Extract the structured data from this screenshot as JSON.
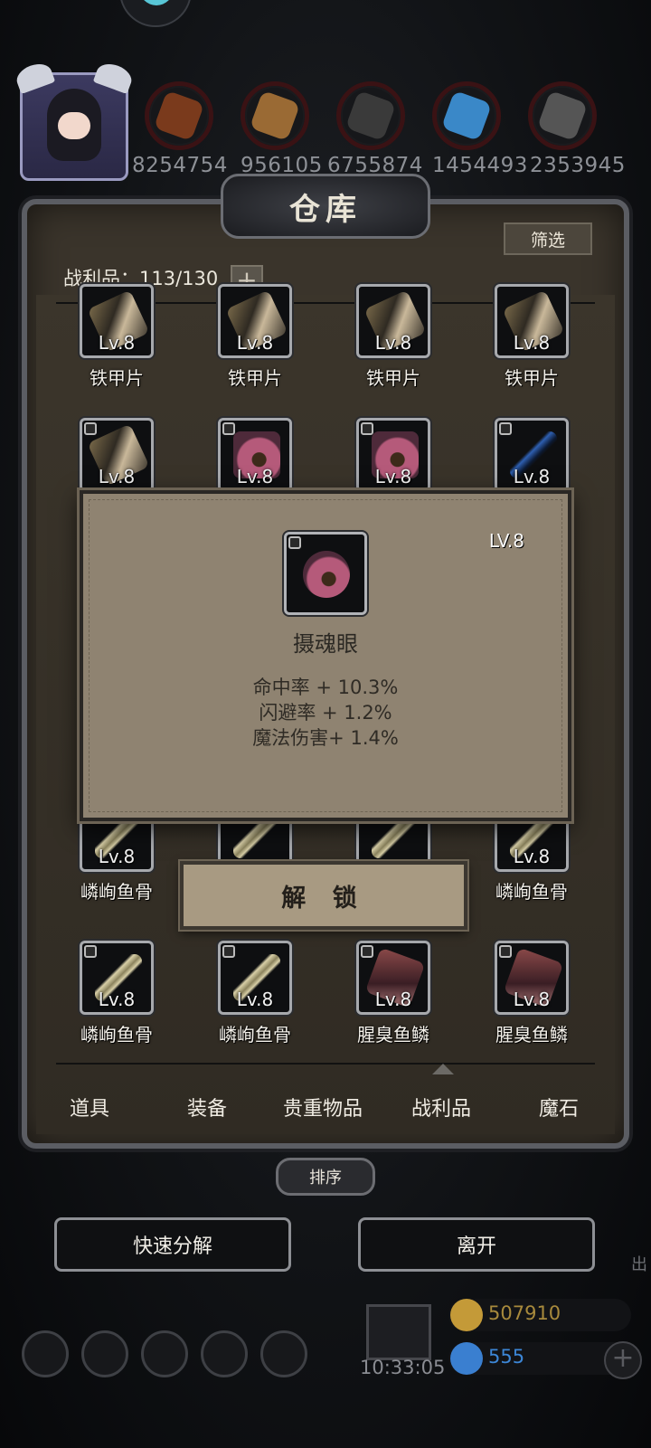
{
  "resources": [
    {
      "icon": "meat-icon",
      "color": "#7a3a1c",
      "count": "8254754"
    },
    {
      "icon": "wood-icon",
      "color": "#9a6a34",
      "count": "956105"
    },
    {
      "icon": "stone-icon",
      "color": "#3a3a3a",
      "count": "6755874"
    },
    {
      "icon": "crystal-icon",
      "color": "#3a88c8",
      "count": "1454493"
    },
    {
      "icon": "iron-icon",
      "color": "#555",
      "count": "2353945"
    }
  ],
  "warehouse": {
    "title": "仓库",
    "filter_label": "筛选",
    "capacity_label": "战利品：113/130",
    "plus_label": "+"
  },
  "grid_rows": [
    [
      {
        "name": "铁甲片",
        "level": "Lv.8",
        "art": "iron"
      },
      {
        "name": "铁甲片",
        "level": "Lv.8",
        "art": "iron"
      },
      {
        "name": "铁甲片",
        "level": "Lv.8",
        "art": "iron"
      },
      {
        "name": "铁甲片",
        "level": "Lv.8",
        "art": "iron"
      }
    ],
    [
      {
        "name": "",
        "level": "Lv.8",
        "art": "iron"
      },
      {
        "name": "",
        "level": "Lv.8",
        "art": "eye"
      },
      {
        "name": "",
        "level": "Lv.8",
        "art": "eye"
      },
      {
        "name": "",
        "level": "Lv.8",
        "art": "whip"
      }
    ],
    [
      {
        "name": "嶙峋鱼骨",
        "level": "Lv.8",
        "art": "bone"
      },
      {
        "name": "",
        "level": "",
        "art": "bone"
      },
      {
        "name": "",
        "level": "",
        "art": "bone"
      },
      {
        "name": "嶙峋鱼骨",
        "level": "Lv.8",
        "art": "bone"
      }
    ],
    [
      {
        "name": "嶙峋鱼骨",
        "level": "Lv.8",
        "art": "bone"
      },
      {
        "name": "嶙峋鱼骨",
        "level": "Lv.8",
        "art": "bone"
      },
      {
        "name": "腥臭鱼鳞",
        "level": "Lv.8",
        "art": "scale"
      },
      {
        "name": "腥臭鱼鳞",
        "level": "Lv.8",
        "art": "scale"
      }
    ]
  ],
  "tooltip": {
    "level": "LV.8",
    "name": "摄魂眼",
    "stats": [
      "命中率 + 10.3%",
      "闪避率 + 1.2%",
      "魔法伤害+ 1.4%"
    ],
    "unlock_label": "解 锁"
  },
  "tabs": [
    "道具",
    "装备",
    "贵重物品",
    "战利品",
    "魔石"
  ],
  "active_tab": "战利品",
  "sort_label": "排序",
  "quick_decompose_label": "快速分解",
  "leave_label": "离开",
  "bottom": {
    "timer": "10:33:05",
    "gold": "507910",
    "gold_color": "#c49a38",
    "diamonds": "555",
    "diamond_color": "#3a7fd0",
    "side_text": "出"
  }
}
